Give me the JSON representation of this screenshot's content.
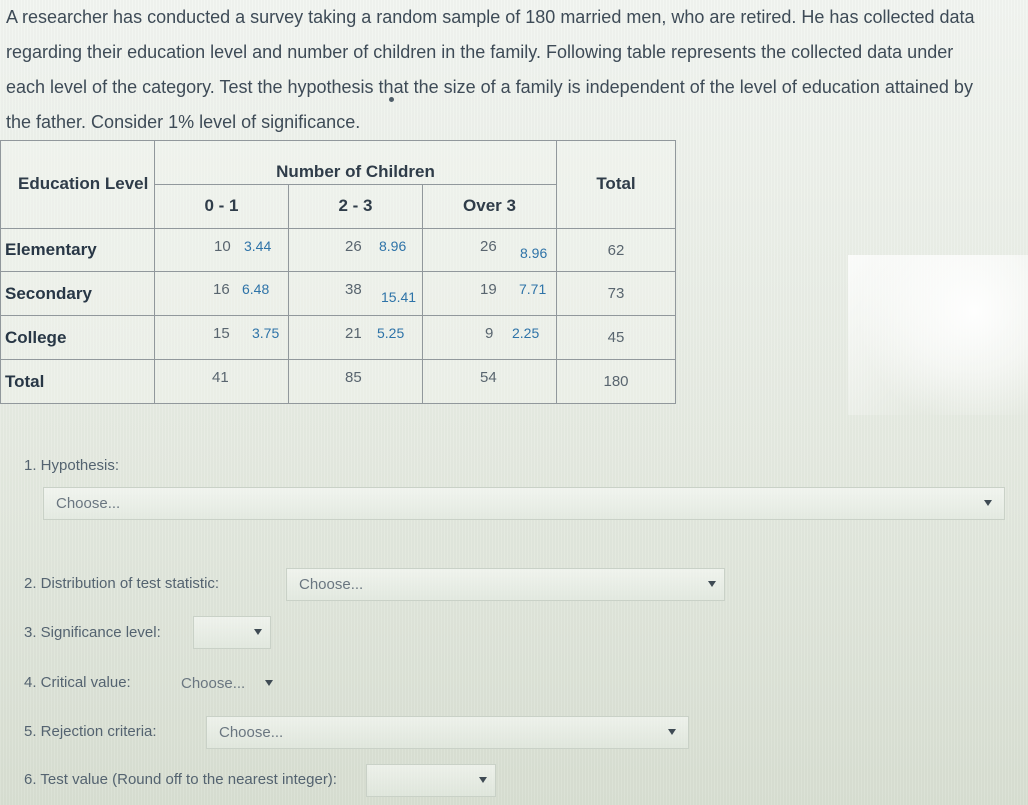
{
  "question": {
    "line1": "A researcher has conducted a survey taking a random sample of 180 married men, who are retired. He has collected data",
    "line2": "regarding their education level and number of children in the family. Following table represents the collected data under",
    "line3": "each level of the category. Test the hypothesis that the size of a family is independent of the level of education attained by",
    "line4": "the father. Consider 1% level of significance."
  },
  "table": {
    "education_header": "Education Level",
    "group_header": "Number of Children",
    "total_header": "Total",
    "subheaders": [
      "0 - 1",
      "2 - 3",
      "Over 3"
    ],
    "rows": [
      {
        "label": "Elementary",
        "c0": {
          "observed": "10",
          "expected": "3.44"
        },
        "c1": {
          "observed": "26",
          "expected": "8.96"
        },
        "c2": {
          "observed": "26",
          "expected": "8.96"
        },
        "total": "62"
      },
      {
        "label": "Secondary",
        "c0": {
          "observed": "16",
          "expected": "6.48"
        },
        "c1": {
          "observed": "38",
          "expected": "15.41"
        },
        "c2": {
          "observed": "19",
          "expected": "7.71"
        },
        "total": "73"
      },
      {
        "label": "College",
        "c0": {
          "observed": "15",
          "expected": "3.75"
        },
        "c1": {
          "observed": "21",
          "expected": "5.25"
        },
        "c2": {
          "observed": "9",
          "expected": "2.25"
        },
        "total": "45"
      },
      {
        "label": "Total",
        "c0": "41",
        "c1": "85",
        "c2": "54",
        "total": "180"
      }
    ]
  },
  "form": {
    "hypothesis_label": "1. Hypothesis:",
    "hypothesis_value": "Choose...",
    "distribution_label": "2. Distribution of test statistic:",
    "distribution_value": "Choose...",
    "significance_label": "3. Significance level:",
    "significance_value": "",
    "critical_label": "4. Critical value:",
    "critical_value": "Choose...",
    "rejection_label": "5. Rejection criteria:",
    "rejection_value": "Choose...",
    "test_value_label": "6. Test value (Round off to the nearest integer):",
    "test_value": ""
  },
  "icons": {
    "caret": "caret-down-icon"
  }
}
